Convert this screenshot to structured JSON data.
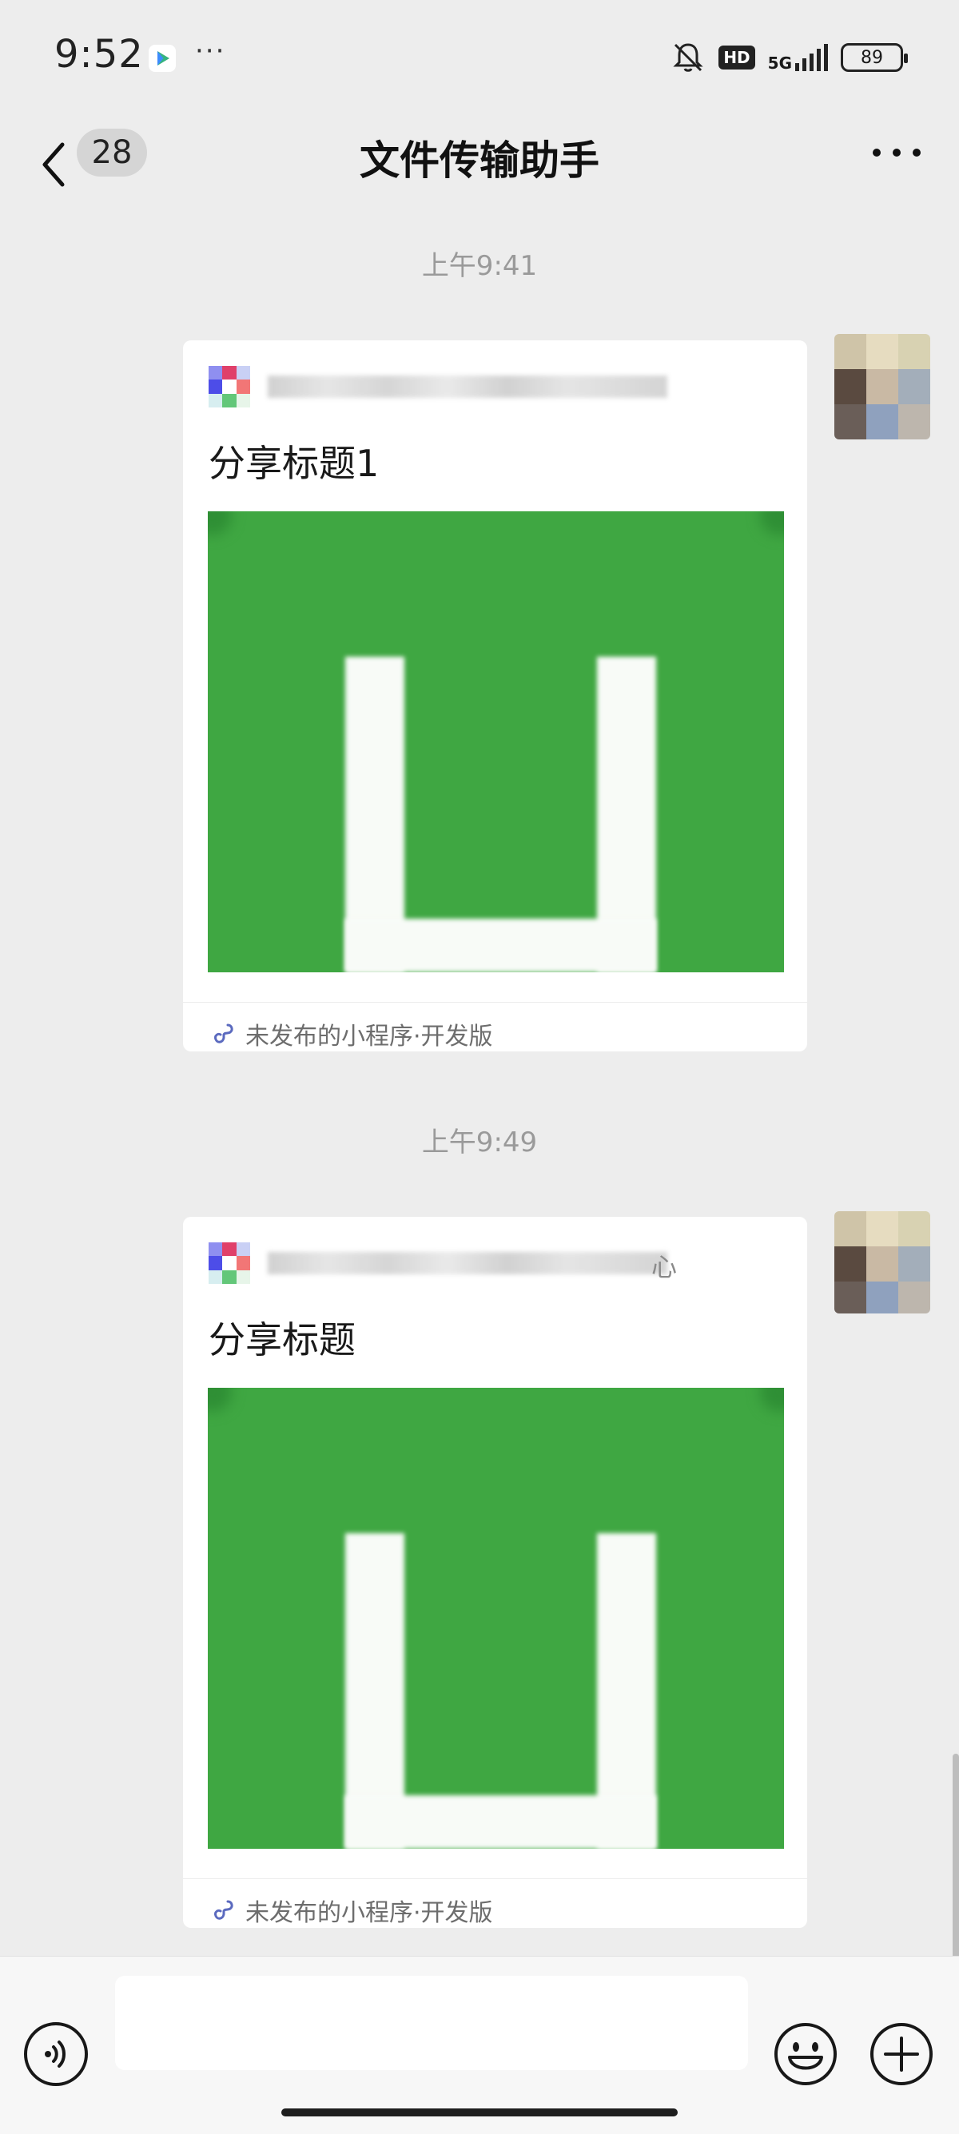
{
  "status_bar": {
    "time": "9:52",
    "dots": "···",
    "hd": "HD",
    "network": "5G",
    "battery": "89"
  },
  "nav": {
    "unread_count": "28",
    "title": "文件传输助手"
  },
  "messages": [
    {
      "timestamp": "上午9:41",
      "card_title": "分享标题1",
      "mini_program_name_suffix": "",
      "footer": "未发布的小程序·开发版"
    },
    {
      "timestamp": "上午9:49",
      "card_title": "分享标题",
      "mini_program_name_suffix": "心",
      "footer": "未发布的小程序·开发版"
    }
  ],
  "input_bar": {
    "placeholder": ""
  },
  "colors": {
    "background": "#ededed",
    "card_image_green": "#3fa742",
    "footer_text": "#6d6d6d"
  },
  "icons": {
    "back": "chevron-left-icon",
    "more": "more-dots-icon",
    "voice": "voice-icon",
    "emoji": "emoji-icon",
    "plus": "plus-icon",
    "mini_program": "mini-program-link-icon",
    "mute": "bell-muted-icon"
  }
}
